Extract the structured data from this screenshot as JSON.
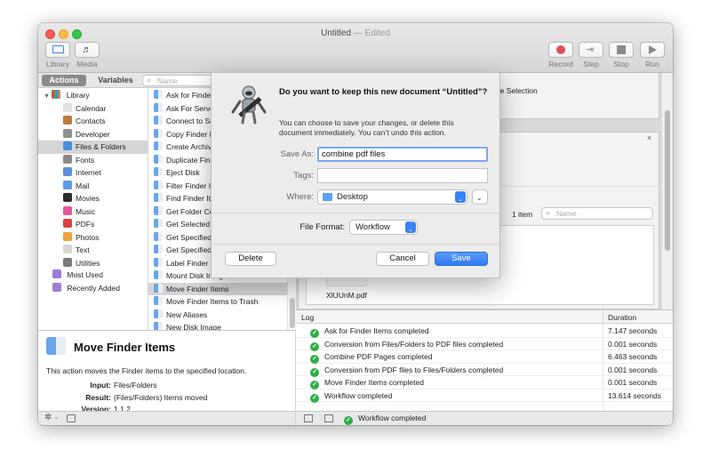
{
  "window": {
    "title": "Untitled",
    "title_suffix": "— Edited"
  },
  "toolbar": {
    "library_label": "Library",
    "media_label": "Media",
    "record_label": "Record",
    "step_label": "Step",
    "stop_label": "Stop",
    "run_label": "Run"
  },
  "library_tabs": {
    "actions": "Actions",
    "variables": "Variables",
    "search_placeholder": "Name"
  },
  "categories": {
    "root": "Library",
    "items": [
      "Calendar",
      "Contacts",
      "Developer",
      "Files & Folders",
      "Fonts",
      "Internet",
      "Mail",
      "Movies",
      "Music",
      "PDFs",
      "Photos",
      "Text",
      "Utilities"
    ],
    "most_used": "Most Used",
    "recently_added": "Recently Added"
  },
  "actions_list": [
    "Ask for Finder Items",
    "Ask For Servers",
    "Connect to Servers",
    "Copy Finder Items",
    "Create Archive",
    "Duplicate Finder Items",
    "Eject Disk",
    "Filter Finder Items",
    "Find Finder Items",
    "Get Folder Contents",
    "Get Selected Finder Items",
    "Get Specified Finder Items",
    "Get Specified Servers",
    "Label Finder Items",
    "Mount Disk Image",
    "Move Finder Items",
    "Move Finder Items to Trash",
    "New Aliases",
    "New Disk Image"
  ],
  "description": {
    "title": "Move Finder Items",
    "text": "This action moves the Finder items to the specified location.",
    "input_label": "Input:",
    "input_value": "Files/Folders",
    "result_label": "Result:",
    "result_value": "(Files/Folders) Items moved",
    "version_label": "Version:",
    "version_value": "1.1.2"
  },
  "workflow": {
    "partial_text": "ple Selection",
    "items_count": "1 item",
    "search_placeholder": "Name",
    "file_name": "XlUUnM.pdf"
  },
  "log": {
    "header_log": "Log",
    "header_duration": "Duration",
    "rows": [
      {
        "text": "Ask for Finder Items completed",
        "duration": "7.147 seconds"
      },
      {
        "text": "Conversion from Files/Folders to PDF files completed",
        "duration": "0.001 seconds"
      },
      {
        "text": "Combine PDF Pages completed",
        "duration": "6.463 seconds"
      },
      {
        "text": "Conversion from PDF files to Files/Folders completed",
        "duration": "0.001 seconds"
      },
      {
        "text": "Move Finder Items completed",
        "duration": "0.001 seconds"
      },
      {
        "text": "Workflow completed",
        "duration": "13.614 seconds"
      }
    ]
  },
  "status": {
    "text": "Workflow completed"
  },
  "dialog": {
    "heading": "Do you want to keep this new document “Untitled”?",
    "message": "You can choose to save your changes, or delete this document immediately. You can’t undo this action.",
    "save_as_label": "Save As:",
    "save_as_value": "combine pdf files",
    "tags_label": "Tags:",
    "where_label": "Where:",
    "where_value": "Desktop",
    "format_label": "File Format:",
    "format_value": "Workflow",
    "delete_button": "Delete",
    "cancel_button": "Cancel",
    "save_button": "Save"
  },
  "colors": {
    "accent": "#3a82f7",
    "success": "#2fae49",
    "record": "#e0505a"
  }
}
